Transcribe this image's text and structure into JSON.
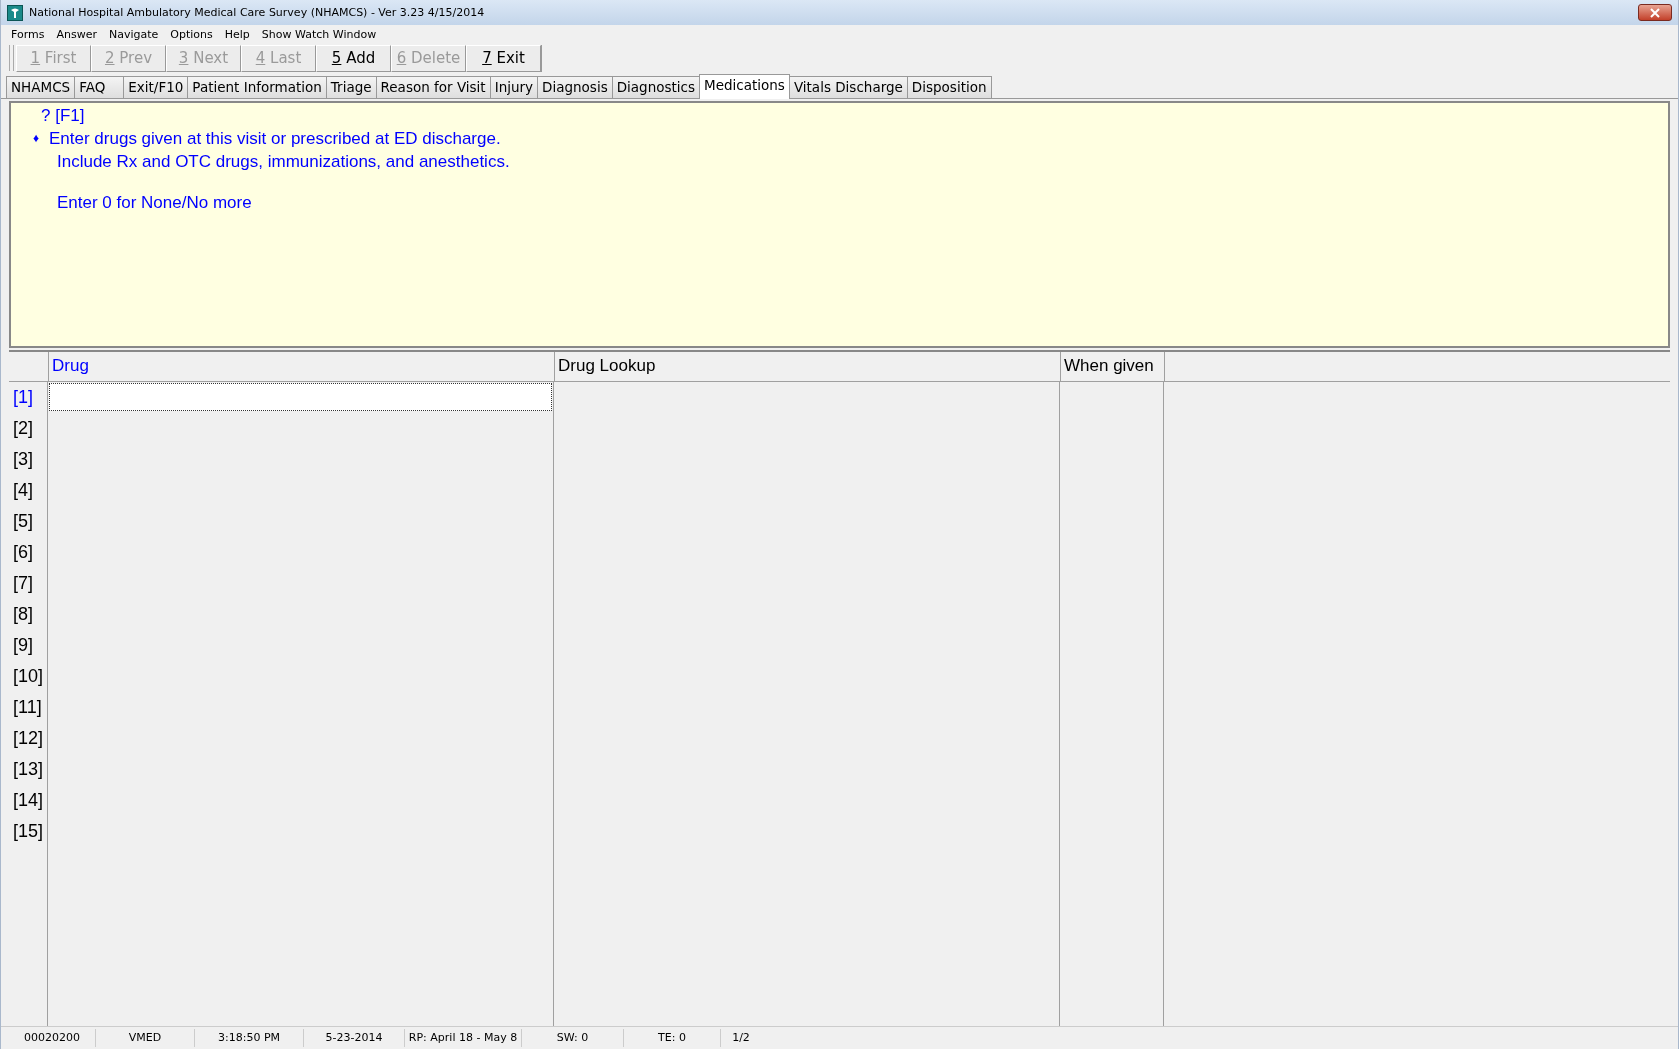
{
  "window": {
    "title": "National Hospital Ambulatory Medical Care Survey (NHAMCS) - Ver 3.23 4/15/2014"
  },
  "menu": [
    "Forms",
    "Answer",
    "Navigate",
    "Options",
    "Help",
    "Show Watch Window"
  ],
  "toolbar": [
    {
      "key": "1",
      "label": "First",
      "disabled": true
    },
    {
      "key": "2",
      "label": "Prev",
      "disabled": true
    },
    {
      "key": "3",
      "label": "Next",
      "disabled": true
    },
    {
      "key": "4",
      "label": "Last",
      "disabled": true
    },
    {
      "key": "5",
      "label": "Add",
      "disabled": false
    },
    {
      "key": "6",
      "label": "Delete",
      "disabled": true
    },
    {
      "key": "7",
      "label": "Exit",
      "disabled": false
    }
  ],
  "tabs": [
    {
      "label": "NHAMCS",
      "selected": false
    },
    {
      "label": "FAQ",
      "selected": false
    },
    {
      "label": "Exit/F10",
      "selected": false
    },
    {
      "label": "Patient Information",
      "selected": false
    },
    {
      "label": "Triage",
      "selected": false
    },
    {
      "label": "Reason for Visit",
      "selected": false
    },
    {
      "label": "Injury",
      "selected": false
    },
    {
      "label": "Diagnosis",
      "selected": false
    },
    {
      "label": "Diagnostics",
      "selected": false
    },
    {
      "label": "Medications",
      "selected": true
    },
    {
      "label": "Vitals Discharge",
      "selected": false
    },
    {
      "label": "Disposition",
      "selected": false
    }
  ],
  "question": {
    "help": "? [F1]",
    "bullet": "♦",
    "lines": [
      "Enter drugs given at this visit or prescribed at ED discharge.",
      "Include Rx and OTC drugs, immunizations, and anesthetics."
    ],
    "note": "Enter 0 for None/No more"
  },
  "grid": {
    "columns": [
      {
        "label": "Drug",
        "selected": true
      },
      {
        "label": "Drug Lookup",
        "selected": false
      },
      {
        "label": "When given",
        "selected": false
      }
    ],
    "rows": [
      {
        "label": "[1]",
        "selected": true
      },
      {
        "label": "[2]",
        "selected": false
      },
      {
        "label": "[3]",
        "selected": false
      },
      {
        "label": "[4]",
        "selected": false
      },
      {
        "label": "[5]",
        "selected": false
      },
      {
        "label": "[6]",
        "selected": false
      },
      {
        "label": "[7]",
        "selected": false
      },
      {
        "label": "[8]",
        "selected": false
      },
      {
        "label": "[9]",
        "selected": false
      },
      {
        "label": "[10]",
        "selected": false
      },
      {
        "label": "[11]",
        "selected": false
      },
      {
        "label": "[12]",
        "selected": false
      },
      {
        "label": "[13]",
        "selected": false
      },
      {
        "label": "[14]",
        "selected": false
      },
      {
        "label": "[15]",
        "selected": false
      }
    ]
  },
  "status_bar": [
    "00020200",
    "VMED",
    "3:18:50 PM",
    "5-23-2014",
    "RP: April 18  -  May 8",
    "SW: 0",
    "TE: 0",
    "1/2"
  ]
}
